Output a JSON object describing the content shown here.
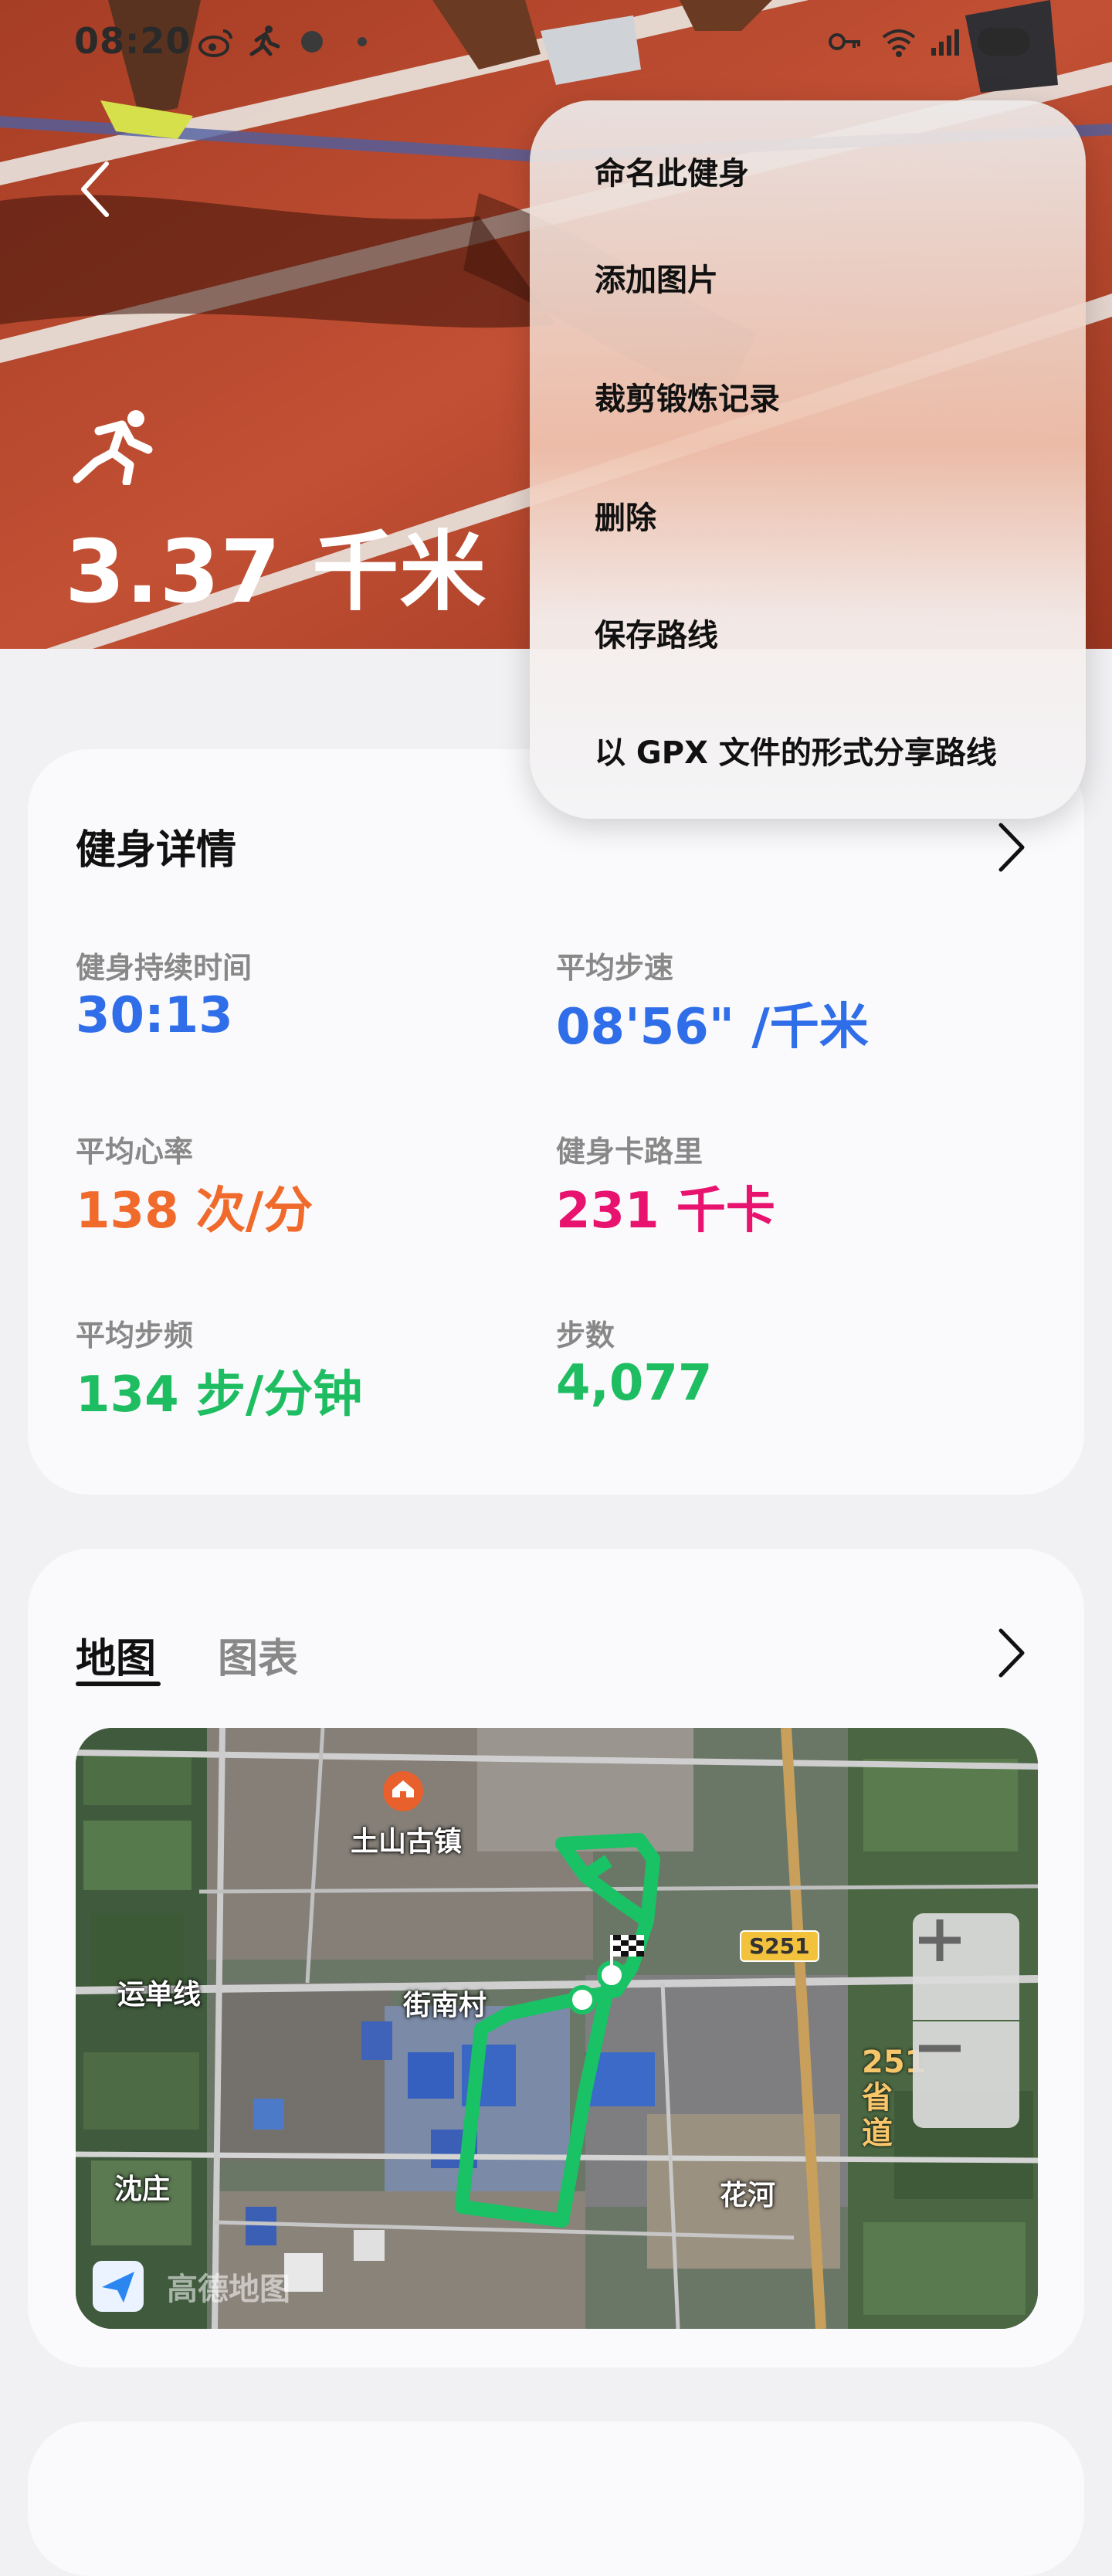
{
  "status_bar": {
    "time": "08:20"
  },
  "hero": {
    "distance": "3.37 千米"
  },
  "menu": {
    "items": [
      "命名此健身",
      "添加图片",
      "裁剪锻炼记录",
      "删除",
      "保存路线",
      "以 GPX 文件的形式分享路线"
    ]
  },
  "details": {
    "title": "健身详情",
    "stats": [
      {
        "label": "健身持续时间",
        "value": "30:13",
        "color": "#2f6ee8"
      },
      {
        "label": "平均步速",
        "value": "08'56\" /千米",
        "color": "#2f6ee8"
      },
      {
        "label": "平均心率",
        "value": "138 次/分",
        "color": "#f06a2c"
      },
      {
        "label": "健身卡路里",
        "value": "231 千卡",
        "color": "#e8136e"
      },
      {
        "label": "平均步频",
        "value": "134 步/分钟",
        "color": "#1fbd62"
      },
      {
        "label": "步数",
        "value": "4,077",
        "color": "#1fbd62"
      }
    ]
  },
  "map_card": {
    "tabs": [
      "地图",
      "图表"
    ],
    "labels": {
      "town": "土山古镇",
      "yundan": "运单线",
      "jienan": "街南村",
      "shenzhuang": "沈庄",
      "huahe": "花河",
      "road_badge": "S251",
      "prov_road": "251省道",
      "logo": "高德地图"
    },
    "zoom_in": "+",
    "zoom_out": "−"
  },
  "icons": [
    "back-icon",
    "running-icon",
    "chevron-right-icon",
    "weibo-icon",
    "key-icon",
    "wifi-icon",
    "signal-icon",
    "battery-icon",
    "amap-logo-icon",
    "landmark-icon",
    "finish-flag-icon"
  ]
}
